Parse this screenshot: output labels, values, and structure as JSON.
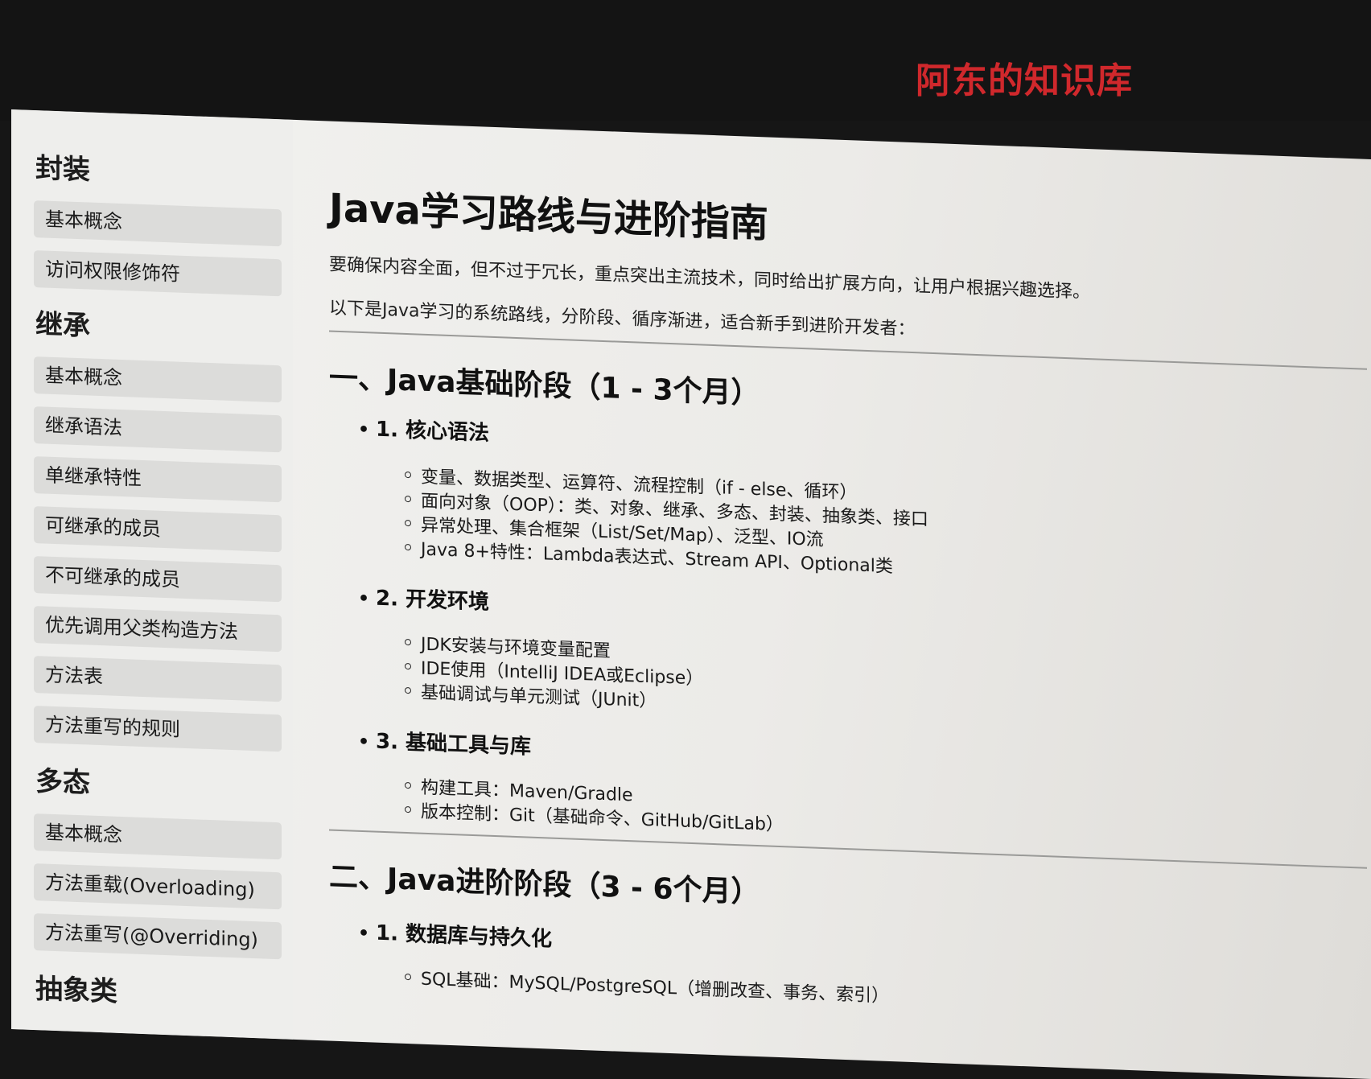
{
  "header": {
    "site_title": "阿东的知识库"
  },
  "sidebar": {
    "groups": [
      {
        "title": "封装",
        "items": [
          "基本概念",
          "访问权限修饰符"
        ]
      },
      {
        "title": "继承",
        "items": [
          "基本概念",
          "继承语法",
          "单继承特性",
          "可继承的成员",
          "不可继承的成员",
          "优先调用父类构造方法",
          "方法表",
          "方法重写的规则"
        ]
      },
      {
        "title": "多态",
        "items": [
          "基本概念",
          "方法重载(Overloading)",
          "方法重写(@Overriding)"
        ]
      },
      {
        "title": "抽象类",
        "items": []
      }
    ]
  },
  "main": {
    "title": "Java学习路线与进阶指南",
    "intro": [
      "要确保内容全面，但不过于冗长，重点突出主流技术，同时给出扩展方向，让用户根据兴趣选择。",
      "以下是Java学习的系统路线，分阶段、循序渐进，适合新手到进阶开发者："
    ],
    "sections": [
      {
        "title": "一、Java基础阶段（1 - 3个月）",
        "subsections": [
          {
            "title": "1. 核心语法",
            "items": [
              "变量、数据类型、运算符、流程控制（if - else、循环）",
              "面向对象（OOP）：类、对象、继承、多态、封装、抽象类、接口",
              "异常处理、集合框架（List/Set/Map）、泛型、IO流",
              "Java 8+特性：Lambda表达式、Stream API、Optional类"
            ]
          },
          {
            "title": "2. 开发环境",
            "items": [
              "JDK安装与环境变量配置",
              "IDE使用（IntelliJ IDEA或Eclipse）",
              "基础调试与单元测试（JUnit）"
            ]
          },
          {
            "title": "3. 基础工具与库",
            "items": [
              "构建工具：Maven/Gradle",
              "版本控制：Git（基础命令、GitHub/GitLab）"
            ]
          }
        ]
      },
      {
        "title": "二、Java进阶阶段（3 - 6个月）",
        "subsections": [
          {
            "title": "1. 数据库与持久化",
            "items": [
              "SQL基础：MySQL/PostgreSQL（增删改查、事务、索引）"
            ]
          }
        ]
      }
    ]
  }
}
